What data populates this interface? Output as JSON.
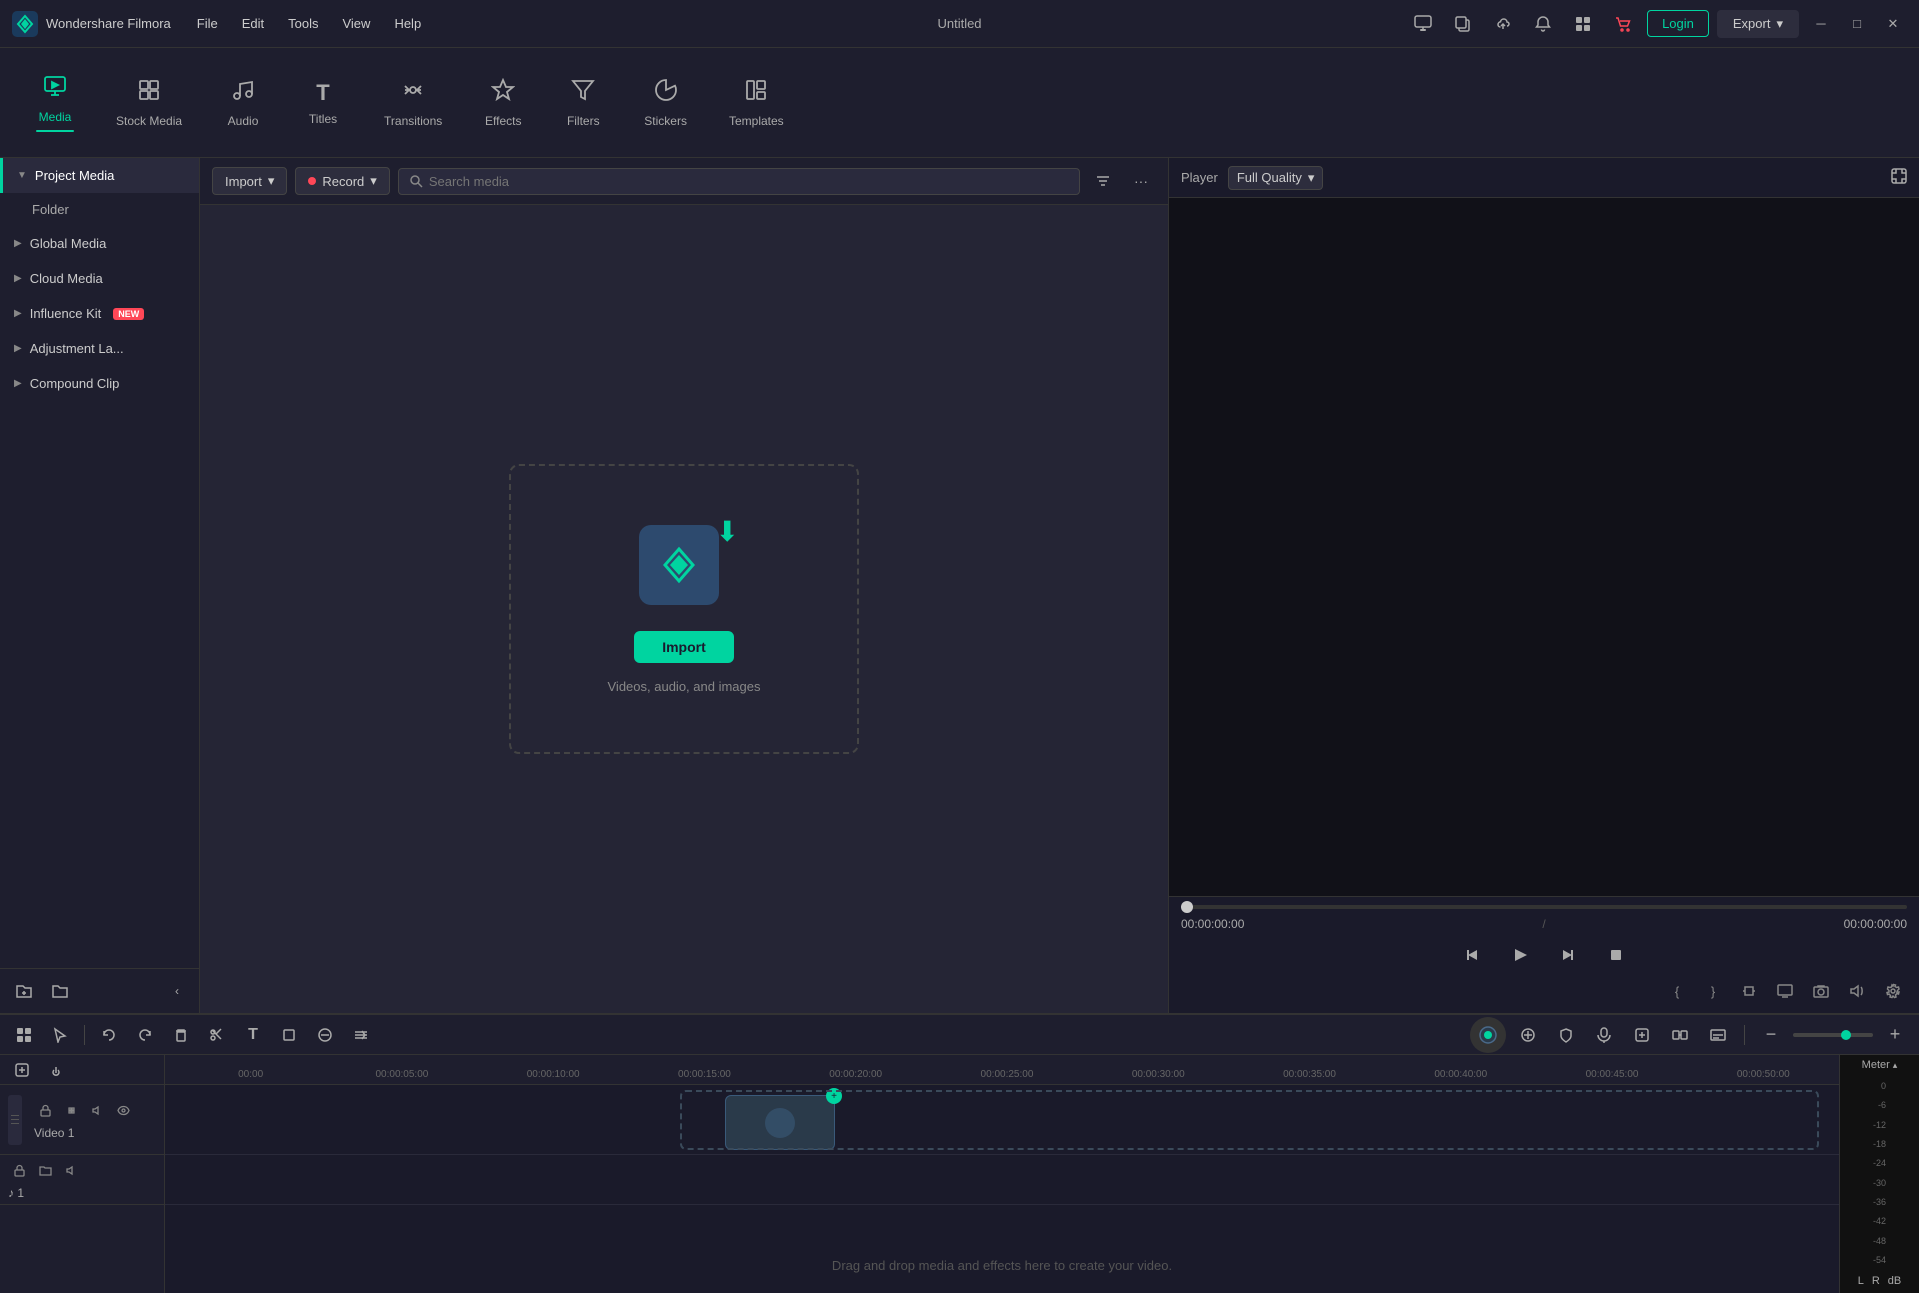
{
  "app": {
    "name": "Wondershare Filmora",
    "window_title": "Untitled"
  },
  "menu": {
    "items": [
      "File",
      "Edit",
      "Tools",
      "View",
      "Help"
    ]
  },
  "titlebar": {
    "icons": [
      "monitor-icon",
      "copy-icon",
      "cloud-icon",
      "bell-icon",
      "grid-icon",
      "cart-icon"
    ],
    "login_label": "Login",
    "export_label": "Export"
  },
  "tabs": [
    {
      "id": "media",
      "label": "Media",
      "icon": "🎬",
      "active": true
    },
    {
      "id": "stock-media",
      "label": "Stock Media",
      "icon": "🖼️",
      "active": false
    },
    {
      "id": "audio",
      "label": "Audio",
      "icon": "🎵",
      "active": false
    },
    {
      "id": "titles",
      "label": "Titles",
      "icon": "T",
      "active": false
    },
    {
      "id": "transitions",
      "label": "Transitions",
      "icon": "↔️",
      "active": false
    },
    {
      "id": "effects",
      "label": "Effects",
      "icon": "✨",
      "active": false
    },
    {
      "id": "filters",
      "label": "Filters",
      "icon": "🔧",
      "active": false
    },
    {
      "id": "stickers",
      "label": "Stickers",
      "icon": "⭐",
      "active": false
    },
    {
      "id": "templates",
      "label": "Templates",
      "icon": "📋",
      "active": false
    }
  ],
  "sidebar": {
    "items": [
      {
        "id": "project-media",
        "label": "Project Media",
        "expanded": true,
        "active": true,
        "level": 0
      },
      {
        "id": "folder",
        "label": "Folder",
        "level": 1
      },
      {
        "id": "global-media",
        "label": "Global Media",
        "expanded": false,
        "level": 0
      },
      {
        "id": "cloud-media",
        "label": "Cloud Media",
        "expanded": false,
        "level": 0
      },
      {
        "id": "influence-kit",
        "label": "Influence Kit",
        "expanded": false,
        "badge": "NEW",
        "level": 0
      },
      {
        "id": "adjustment-la",
        "label": "Adjustment La...",
        "expanded": false,
        "level": 0
      },
      {
        "id": "compound-clip",
        "label": "Compound Clip",
        "expanded": false,
        "level": 0
      }
    ],
    "bottom_icons": [
      "add-folder-icon",
      "folder-icon",
      "collapse-icon"
    ]
  },
  "media_toolbar": {
    "import_label": "Import",
    "record_label": "Record",
    "search_placeholder": "Search media"
  },
  "drop_zone": {
    "import_btn_label": "Import",
    "hint_text": "Videos, audio, and images"
  },
  "player": {
    "label": "Player",
    "quality_label": "Full Quality",
    "current_time": "00:00:00:00",
    "total_time": "00:00:00:00"
  },
  "timeline": {
    "ruler_marks": [
      "00:00",
      "00:00:05:00",
      "00:00:10:00",
      "00:00:15:00",
      "00:00:20:00",
      "00:00:25:00",
      "00:00:30:00",
      "00:00:35:00",
      "00:00:40:00",
      "00:00:45:00",
      "00:00:50:00"
    ],
    "tracks": [
      {
        "id": "video1",
        "name": "Video 1",
        "type": "video"
      },
      {
        "id": "audio1",
        "name": "",
        "type": "audio"
      }
    ],
    "drag_hint": "Drag and drop media and effects here to create your video.",
    "meter_label": "Meter",
    "meter_labels": [
      "0",
      "-6",
      "-12",
      "-18",
      "-24",
      "-30",
      "-36",
      "-42",
      "-48",
      "-54"
    ],
    "lr_labels": [
      "L",
      "R",
      "dB"
    ]
  }
}
